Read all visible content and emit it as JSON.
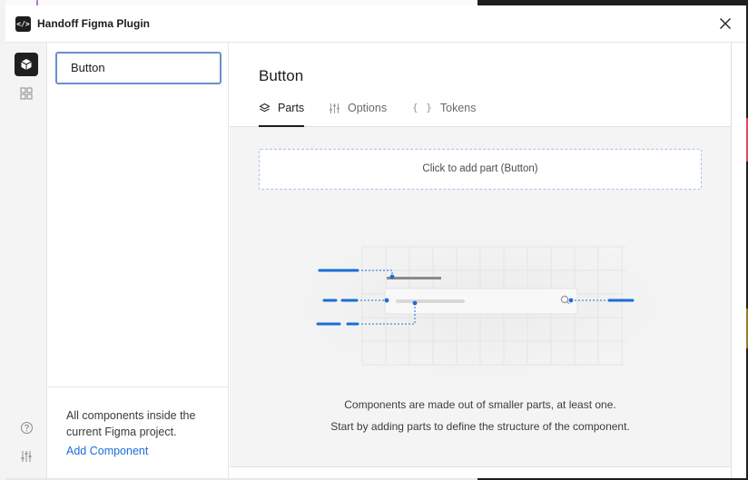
{
  "window": {
    "title": "Handoff Figma Plugin",
    "logo_glyph": "</>",
    "icons": {
      "logo": "code-brackets-icon",
      "close": "close-icon"
    }
  },
  "rail": {
    "items": [
      {
        "icon": "component-cube-icon",
        "active": true
      },
      {
        "icon": "grid-icon",
        "active": false
      }
    ],
    "bottom_icons": [
      "help-icon",
      "sliders-icon"
    ]
  },
  "components": {
    "items": [
      {
        "label": "Button",
        "selected": true
      }
    ],
    "footer_text": "All components inside the current Figma project.",
    "add_label": "Add Component"
  },
  "main": {
    "title": "Button",
    "tabs": [
      {
        "label": "Parts",
        "icon": "layers-icon",
        "active": true
      },
      {
        "label": "Options",
        "icon": "sliders-icon",
        "active": false
      },
      {
        "label": "Tokens",
        "icon": "braces-icon",
        "glyph": "{ }",
        "active": false
      }
    ],
    "add_part_label": "Click to add part (Button)",
    "empty_line1": "Components are made out of smaller parts, at least one.",
    "empty_line2": "Start by adding parts to define the structure of the component."
  },
  "colors": {
    "accent": "#1a6ed8",
    "selection_border": "#6b8fd0",
    "active_rail": "#1f1f1f",
    "dashed_border": "#a9c2e6"
  }
}
